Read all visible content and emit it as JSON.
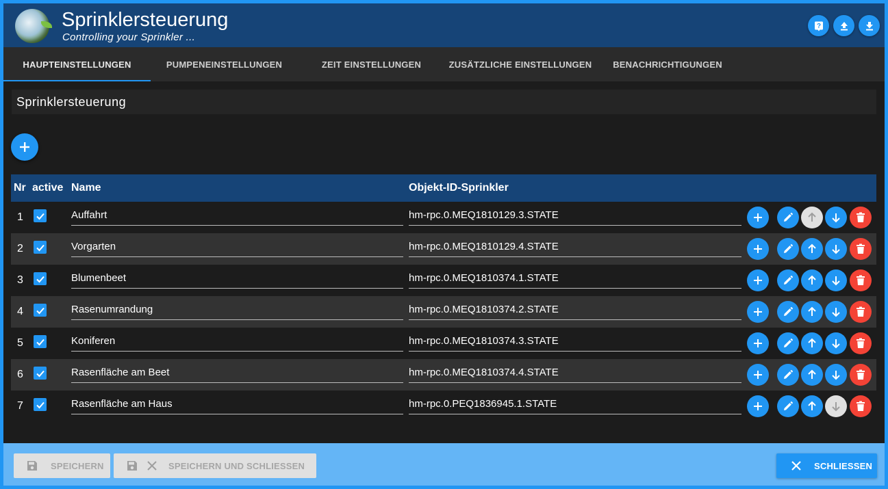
{
  "header": {
    "title": "Sprinklersteuerung",
    "subtitle": "Controlling your Sprinkler ...",
    "buttons": [
      "help-icon",
      "upload-icon",
      "download-icon"
    ]
  },
  "tabs": [
    {
      "label": "HAUPTEINSTELLUNGEN",
      "active": true
    },
    {
      "label": "PUMPENEINSTELLUNGEN",
      "active": false
    },
    {
      "label": "ZEIT EINSTELLUNGEN",
      "active": false
    },
    {
      "label": "ZUSÄTZLICHE EINSTELLUNGEN",
      "active": false
    },
    {
      "label": "BENACHRICHTIGUNGEN",
      "active": false
    }
  ],
  "section": {
    "title": "Sprinklersteuerung"
  },
  "table": {
    "headers": {
      "nr": "Nr",
      "active": "active",
      "name": "Name",
      "object_id": "Objekt-ID-Sprinkler"
    },
    "rows": [
      {
        "nr": "1",
        "active": true,
        "name": "Auffahrt",
        "object_id": "hm-rpc.0.MEQ1810129.3.STATE",
        "up_disabled": true,
        "down_disabled": false
      },
      {
        "nr": "2",
        "active": true,
        "name": "Vorgarten",
        "object_id": "hm-rpc.0.MEQ1810129.4.STATE",
        "up_disabled": false,
        "down_disabled": false
      },
      {
        "nr": "3",
        "active": true,
        "name": "Blumenbeet",
        "object_id": "hm-rpc.0.MEQ1810374.1.STATE",
        "up_disabled": false,
        "down_disabled": false
      },
      {
        "nr": "4",
        "active": true,
        "name": "Rasenumrandung",
        "object_id": "hm-rpc.0.MEQ1810374.2.STATE",
        "up_disabled": false,
        "down_disabled": false
      },
      {
        "nr": "5",
        "active": true,
        "name": "Koniferen",
        "object_id": "hm-rpc.0.MEQ1810374.3.STATE",
        "up_disabled": false,
        "down_disabled": false
      },
      {
        "nr": "6",
        "active": true,
        "name": "Rasenfläche am Beet",
        "object_id": "hm-rpc.0.MEQ1810374.4.STATE",
        "up_disabled": false,
        "down_disabled": false
      },
      {
        "nr": "7",
        "active": true,
        "name": "Rasenfläche am Haus",
        "object_id": "hm-rpc.0.PEQ1836945.1.STATE",
        "up_disabled": false,
        "down_disabled": true
      }
    ]
  },
  "footer": {
    "save_label": "SPEICHERN",
    "save_close_label": "SPEICHERN UND SCHLIESSEN",
    "close_label": "SCHLIESSEN"
  },
  "colors": {
    "accent": "#2196f3",
    "header_bg": "#164477",
    "danger": "#f44336",
    "footer_bg": "#64b5f6"
  }
}
